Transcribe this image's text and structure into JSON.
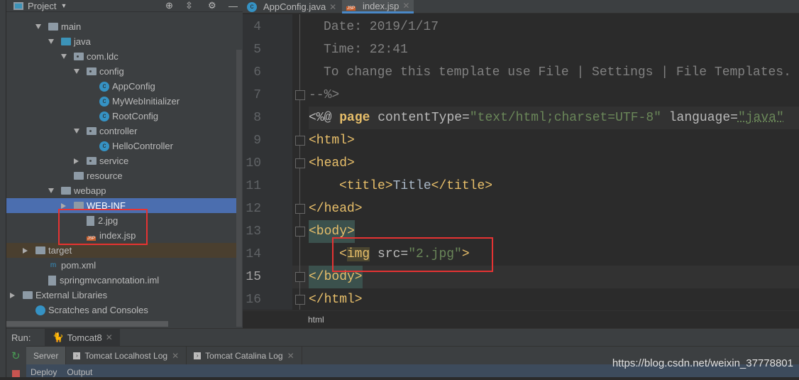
{
  "project_panel": {
    "title": "Project",
    "tree": [
      {
        "label": "main",
        "depth": 2,
        "icon": "folder",
        "open": true
      },
      {
        "label": "java",
        "depth": 3,
        "icon": "folder-blue",
        "open": true
      },
      {
        "label": "com.ldc",
        "depth": 4,
        "icon": "package",
        "open": true
      },
      {
        "label": "config",
        "depth": 5,
        "icon": "package",
        "open": true
      },
      {
        "label": "AppConfig",
        "depth": 6,
        "icon": "class"
      },
      {
        "label": "MyWebInitializer",
        "depth": 6,
        "icon": "class"
      },
      {
        "label": "RootConfig",
        "depth": 6,
        "icon": "class"
      },
      {
        "label": "controller",
        "depth": 5,
        "icon": "package",
        "open": true
      },
      {
        "label": "HelloController",
        "depth": 6,
        "icon": "class"
      },
      {
        "label": "service",
        "depth": 5,
        "icon": "package",
        "open": false
      },
      {
        "label": "resource",
        "depth": 4,
        "icon": "folder"
      },
      {
        "label": "webapp",
        "depth": 3,
        "icon": "folder",
        "open": true
      },
      {
        "label": "WEB-INF",
        "depth": 4,
        "icon": "folder",
        "open": false,
        "selected": true
      },
      {
        "label": "2.jpg",
        "depth": 5,
        "icon": "file"
      },
      {
        "label": "index.jsp",
        "depth": 5,
        "icon": "jsp"
      },
      {
        "label": "target",
        "depth": 1,
        "icon": "folder",
        "open": false,
        "excluded": true
      },
      {
        "label": "pom.xml",
        "depth": 2,
        "icon": "maven"
      },
      {
        "label": "springmvcannotation.iml",
        "depth": 2,
        "icon": "file"
      },
      {
        "label": "External Libraries",
        "depth": 0,
        "icon": "library",
        "open": false
      },
      {
        "label": "Scratches and Consoles",
        "depth": 1,
        "icon": "scratch"
      }
    ]
  },
  "editor": {
    "tabs": [
      {
        "label": "AppConfig.java",
        "active": false
      },
      {
        "label": "index.jsp",
        "active": true
      }
    ],
    "line_numbers": [
      "4",
      "5",
      "6",
      "7",
      "8",
      "9",
      "10",
      "11",
      "12",
      "13",
      "14",
      "15",
      "16"
    ],
    "current_line": "15",
    "lines": {
      "l4": "Date: 2019/1/17",
      "l5": "Time: 22:41",
      "l6": "To change this template use File | Settings | File Templates.",
      "l7": "--%>",
      "l8a": "<%@ ",
      "l8b": "page",
      "l8c": " contentType=",
      "l8d": "\"text/html;charset=UTF-8\"",
      "l8e": " language=",
      "l8f": "\"java\"",
      "l9": "<html>",
      "l10": "<head>",
      "l11a": "<title>",
      "l11b": "Title",
      "l11c": "</title>",
      "l12": "</head>",
      "l13": "<body>",
      "l14a": "<",
      "l14b": "img",
      "l14c": " src=",
      "l14d": "\"2.jpg\"",
      "l14e": ">",
      "l15": "</body>",
      "l16": "</html>"
    },
    "breadcrumb": "html"
  },
  "run": {
    "label": "Run:",
    "config": "Tomcat8",
    "tabs": [
      "Server",
      "Tomcat Localhost Log",
      "Tomcat Catalina Log"
    ],
    "sub_tabs": [
      "Deploy",
      "Output"
    ]
  },
  "watermark": "https://blog.csdn.net/weixin_37778801",
  "colors": {
    "highlight_box": "#e53333",
    "selection": "#4b6eaf"
  }
}
